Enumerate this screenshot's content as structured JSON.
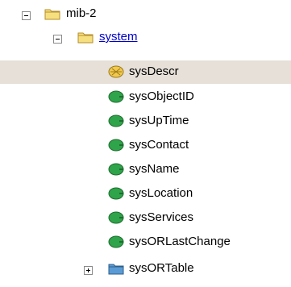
{
  "tree": {
    "root": {
      "label": "mib-2",
      "expanded": true
    },
    "system": {
      "label": "system",
      "expanded": true
    },
    "leaves": [
      {
        "label": "sysDescr",
        "selected": true
      },
      {
        "label": "sysObjectID"
      },
      {
        "label": "sysUpTime"
      },
      {
        "label": "sysContact"
      },
      {
        "label": "sysName"
      },
      {
        "label": "sysLocation"
      },
      {
        "label": "sysServices"
      },
      {
        "label": "sysORLastChange"
      }
    ],
    "table": {
      "label": "sysORTable",
      "expanded": false
    }
  },
  "colors": {
    "selection": "#e6e0d8",
    "leaf_green": "#2fa44a",
    "leaf_selected_yellow": "#f2c94c",
    "folder_yellow": "#f6df7e",
    "folder_blue": "#5b9bd5",
    "link": "#0000cc"
  },
  "icons": {
    "expanded": "minus-box-icon",
    "collapsed": "plus-box-icon",
    "folder": "folder-icon",
    "leaf": "leaf-object-icon",
    "table": "table-folder-icon"
  }
}
